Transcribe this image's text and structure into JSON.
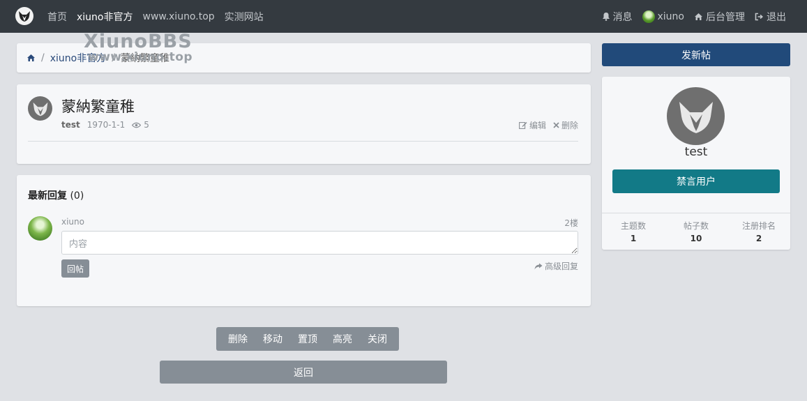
{
  "navbar": {
    "items": [
      {
        "label": "首页"
      },
      {
        "label": "xiuno非官方"
      },
      {
        "label": "www.xiuno.top"
      },
      {
        "label": "实测网站"
      }
    ],
    "right": {
      "messages": "消息",
      "user": "xiuno",
      "admin": "后台管理",
      "logout": "退出"
    }
  },
  "watermark": {
    "title": "XiunoBBS",
    "url": "www.xiuno.top"
  },
  "breadcrumb": {
    "items": [
      {
        "label": "xiuno非官方"
      },
      {
        "label": "蒙納繁童稚"
      }
    ],
    "separator": "/"
  },
  "thread": {
    "title": "蒙納繁童稚",
    "author": "test",
    "date": "1970-1-1",
    "views": "5",
    "edit_label": "编辑",
    "delete_label": "删除"
  },
  "replies": {
    "header": "最新回复",
    "count": "(0)",
    "user": "xiuno",
    "floor": "2楼",
    "input_placeholder": "内容",
    "submit_label": "回帖",
    "advanced_label": "高级回复"
  },
  "moderation": {
    "items": [
      {
        "label": "删除"
      },
      {
        "label": "移动"
      },
      {
        "label": "置顶"
      },
      {
        "label": "高亮"
      },
      {
        "label": "关闭"
      }
    ]
  },
  "back_label": "返回",
  "sidebar": {
    "new_thread_label": "发新帖",
    "profile": {
      "name": "test",
      "ban_label": "禁言用户",
      "stats": [
        {
          "label": "主题数",
          "value": "1"
        },
        {
          "label": "帖子数",
          "value": "10"
        },
        {
          "label": "注册排名",
          "value": "2"
        }
      ]
    }
  },
  "colors": {
    "navbar_bg": "#343a40",
    "primary": "#214a7a",
    "teal": "#127a87",
    "secondary": "#868e96",
    "page_bg": "#dfe1e5"
  }
}
